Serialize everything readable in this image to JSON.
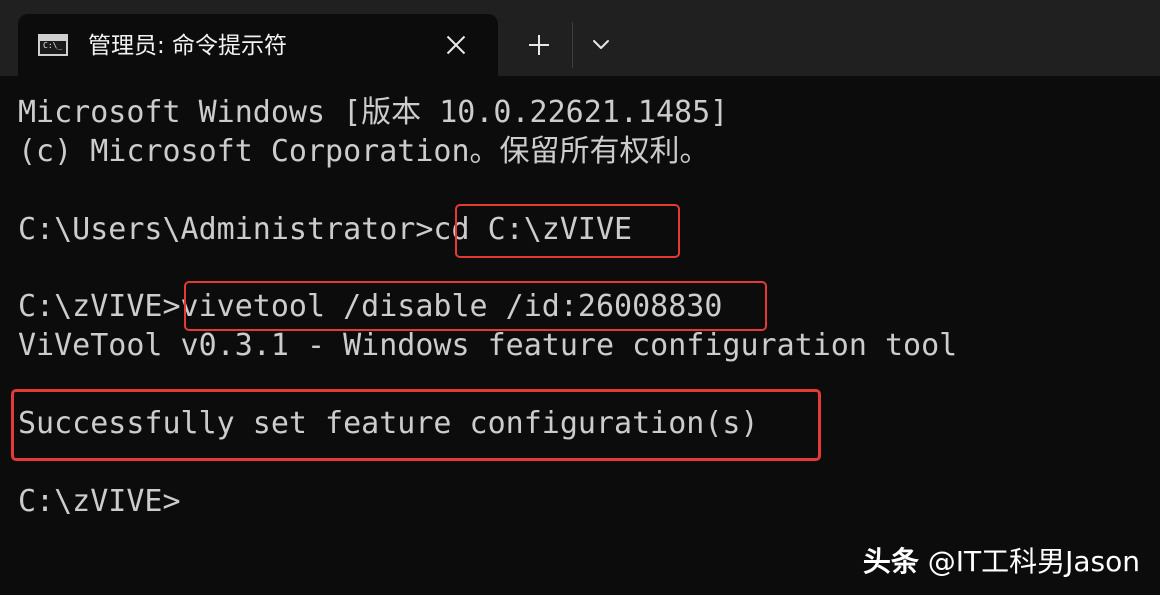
{
  "tab": {
    "title": "管理员: 命令提示符",
    "icon": "terminal-icon",
    "icon_prompt": "C:\\_",
    "close_icon": "close-icon"
  },
  "toolbar": {
    "new_tab_icon": "plus-icon",
    "dropdown_icon": "chevron-down-icon"
  },
  "console": {
    "lines": [
      "Microsoft Windows [版本 10.0.22621.1485]",
      "(c) Microsoft Corporation。保留所有权利。",
      "C:\\Users\\Administrator>cd C:\\zVIVE",
      "C:\\zVIVE>vivetool /disable /id:26008830",
      "ViVeTool v0.3.1 - Windows feature configuration tool",
      "Successfully set feature configuration(s)",
      "C:\\zVIVE>"
    ]
  },
  "highlight_color": "#e53935",
  "watermark": {
    "brand": "头条",
    "handle": " @IT工科男Jason"
  }
}
